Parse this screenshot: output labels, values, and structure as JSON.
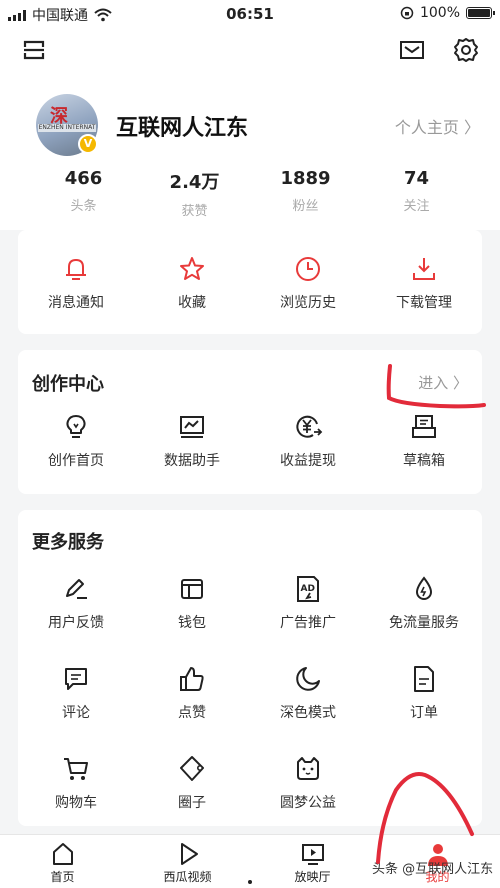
{
  "status_bar": {
    "carrier": "中国联通",
    "time": "06:51",
    "battery": "100%"
  },
  "profile": {
    "name": "互联网人江东",
    "home_link": "个人主页 〉",
    "avatar_text": "深",
    "avatar_banner": "ENZHEN INTERNAT",
    "badge": "V",
    "stats": [
      {
        "value": "466",
        "label": "头条"
      },
      {
        "value": "2.4万",
        "label": "获赞"
      },
      {
        "value": "1889",
        "label": "粉丝"
      },
      {
        "value": "74",
        "label": "关注"
      }
    ]
  },
  "quick_actions": [
    {
      "label": "消息通知",
      "icon": "bell-icon"
    },
    {
      "label": "收藏",
      "icon": "star-icon"
    },
    {
      "label": "浏览历史",
      "icon": "clock-icon"
    },
    {
      "label": "下载管理",
      "icon": "download-icon"
    }
  ],
  "creator_center": {
    "title": "创作中心",
    "enter": "进入 〉",
    "items": [
      {
        "label": "创作首页",
        "icon": "bulb-icon"
      },
      {
        "label": "数据助手",
        "icon": "chart-icon"
      },
      {
        "label": "收益提现",
        "icon": "yuan-icon"
      },
      {
        "label": "草稿箱",
        "icon": "drafts-icon"
      }
    ]
  },
  "more_services": {
    "title": "更多服务",
    "rows": [
      [
        {
          "label": "用户反馈",
          "icon": "pen-icon"
        },
        {
          "label": "钱包",
          "icon": "wallet-icon"
        },
        {
          "label": "广告推广",
          "icon": "ad-icon"
        },
        {
          "label": "免流量服务",
          "icon": "drop-icon"
        }
      ],
      [
        {
          "label": "评论",
          "icon": "comment-icon"
        },
        {
          "label": "点赞",
          "icon": "thumb-icon"
        },
        {
          "label": "深色模式",
          "icon": "moon-icon"
        },
        {
          "label": "订单",
          "icon": "order-icon"
        }
      ],
      [
        {
          "label": "购物车",
          "icon": "cart-icon"
        },
        {
          "label": "圈子",
          "icon": "circle-icon"
        },
        {
          "label": "圆梦公益",
          "icon": "cat-icon"
        }
      ]
    ]
  },
  "tabbar": [
    {
      "label": "首页",
      "icon": "home-icon"
    },
    {
      "label": "西瓜视频",
      "icon": "play-icon"
    },
    {
      "label": "放映厅",
      "icon": "screen-icon"
    },
    {
      "label": "我的",
      "icon": "user-icon"
    }
  ],
  "watermark": "头条 @互联网人江东",
  "colors": {
    "accent": "#e83a3a",
    "annotation": "#e22b3a"
  }
}
